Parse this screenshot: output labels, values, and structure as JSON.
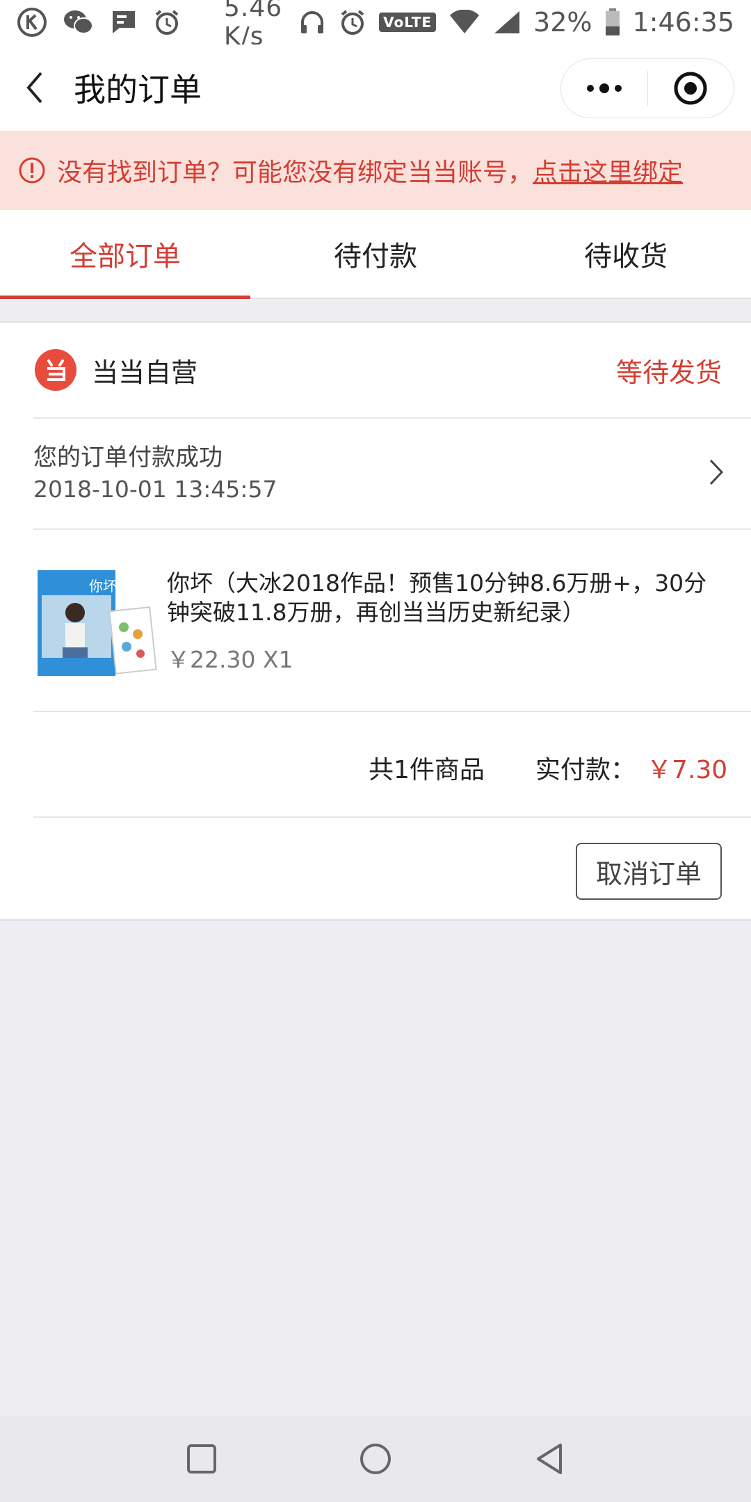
{
  "status_bar": {
    "net_speed": "5.46 K/s",
    "volte": "VoLTE",
    "battery": "32%",
    "time": "1:46:35"
  },
  "nav": {
    "title": "我的订单"
  },
  "notice": {
    "text": "没有找到订单？可能您没有绑定当当账号，",
    "link": "点击这里绑定"
  },
  "tabs": [
    {
      "label": "全部订单",
      "active": true
    },
    {
      "label": "待付款",
      "active": false
    },
    {
      "label": "待收货",
      "active": false
    }
  ],
  "order": {
    "shop_name": "当当自营",
    "status": "等待发货",
    "message": "您的订单付款成功",
    "time": "2018-10-01 13:45:57",
    "product": {
      "title": "你坏（大冰2018作品！预售10分钟8.6万册+，30分钟突破11.8万册，再创当当历史新纪录）",
      "price_qty": "￥22.30 X1",
      "cover_text": "你坏"
    },
    "summary_count": "共1件商品",
    "paid_label": "实付款：",
    "paid_value": "￥7.30",
    "cancel_label": "取消订单"
  },
  "colors": {
    "accent": "#d43d32",
    "notice_bg": "#fbe1dc",
    "page_bg": "#eeeef2"
  }
}
